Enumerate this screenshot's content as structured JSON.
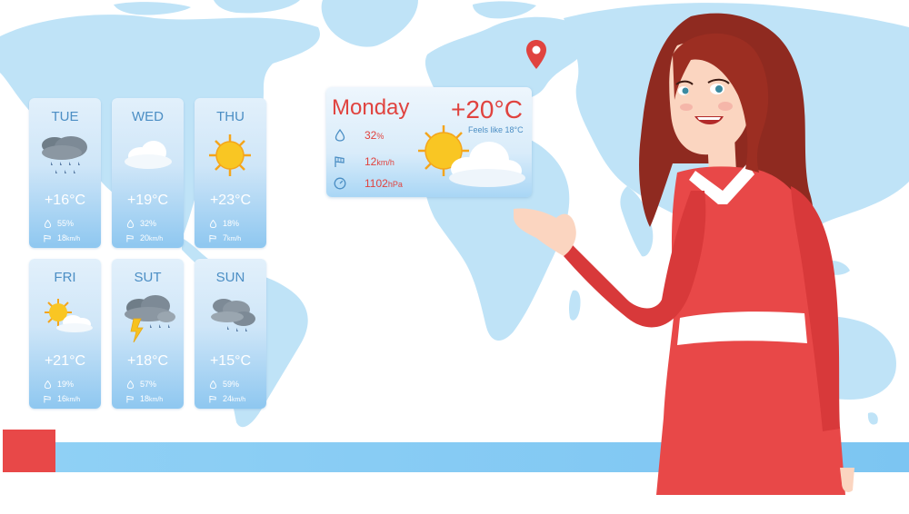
{
  "colors": {
    "accent_red": "#e0433f",
    "label_blue": "#4b8ec4",
    "map_blue": "#bfe3f7",
    "ticker_blue": "#7cc5f2",
    "ticker_red": "#e84848"
  },
  "forecast": [
    {
      "day": "TUE",
      "temp": "+16°C",
      "humidity": "55%",
      "wind_value": "18",
      "wind_unit": "km/h",
      "icon": "rain-cloud-icon"
    },
    {
      "day": "WED",
      "temp": "+19°C",
      "humidity": "32%",
      "wind_value": "20",
      "wind_unit": "km/h",
      "icon": "cloud-icon"
    },
    {
      "day": "THU",
      "temp": "+23°C",
      "humidity": "18%",
      "wind_value": "7",
      "wind_unit": "km/h",
      "icon": "sun-icon"
    },
    {
      "day": "FRI",
      "temp": "+21°C",
      "humidity": "19%",
      "wind_value": "16",
      "wind_unit": "km/h",
      "icon": "partly-cloudy-icon"
    },
    {
      "day": "SUT",
      "temp": "+18°C",
      "humidity": "57%",
      "wind_value": "18",
      "wind_unit": "km/h",
      "icon": "thunderstorm-icon"
    },
    {
      "day": "SUN",
      "temp": "+15°C",
      "humidity": "59%",
      "wind_value": "24",
      "wind_unit": "km/h",
      "icon": "cloudy-rain-icon"
    }
  ],
  "today": {
    "day": "Monday",
    "temp": "+20°C",
    "feels_like": "Feels like 18°C",
    "humidity_value": "32",
    "humidity_unit": "%",
    "wind_value": "12",
    "wind_unit": "km/h",
    "pressure_value": "1102",
    "pressure_unit": "hPa",
    "icon": "sun-behind-cloud-icon"
  }
}
